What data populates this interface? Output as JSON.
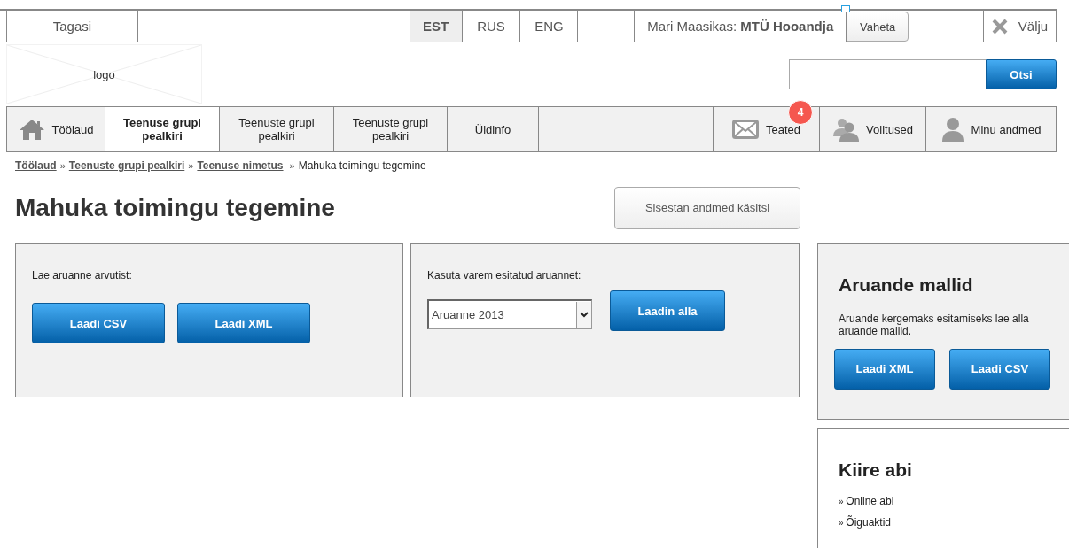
{
  "top_bar": {
    "back": "Tagasi",
    "languages": [
      {
        "label": "EST",
        "selected": true
      },
      {
        "label": "RUS",
        "selected": false
      },
      {
        "label": "ENG",
        "selected": false
      }
    ],
    "user": "Mari Maasikas: **MTÜ Hooandja**",
    "switch_button": "Vaheta",
    "logout": "Välju"
  },
  "logo": "logo",
  "search": {
    "button": "Otsi"
  },
  "nav": [
    {
      "label": "Töölaud",
      "kind": "home",
      "selected": false
    },
    {
      "label": "Teenuse grupi pealkiri",
      "kind": "text",
      "selected": true
    },
    {
      "label": "Teenuste grupi pealkiri",
      "kind": "text",
      "selected": false
    },
    {
      "label": "Teenuste grupi pealkiri",
      "kind": "text",
      "selected": false
    },
    {
      "label": "Üldinfo",
      "kind": "text",
      "selected": false
    },
    {
      "label": "Teated",
      "kind": "mail",
      "badge": "4",
      "selected": false
    },
    {
      "label": "Volitused",
      "kind": "users",
      "selected": false
    },
    {
      "label": "Minu andmed",
      "kind": "user",
      "selected": false
    }
  ],
  "breadcrumb": [
    {
      "label": "Töölaud",
      "link": true
    },
    {
      "sep": "»",
      "label": "Teenuste grupi pealkiri",
      "link": true
    },
    {
      "sep": "»",
      "label": "Teenuse nimetus",
      "link": true
    },
    {
      "sep": "»",
      "label": "Mahuka toimingu tegemine",
      "link": false
    }
  ],
  "title": "Mahuka toimingu tegemine",
  "manual_button": "Sisestan andmed käsitsi",
  "upload_panel": {
    "label": "Lae aruanne arvutist:",
    "buttons": [
      "Laadi CSV",
      "Laadi XML"
    ]
  },
  "previous_panel": {
    "label": "Kasuta varem esitatud aruannet:",
    "select_value": "Aruanne 2013",
    "button": "Laadin alla"
  },
  "templates": {
    "title": "Aruande mallid",
    "text": "Aruande kergemaks esitamiseks lae alla aruande mallid.",
    "buttons": [
      "Laadi XML",
      "Laadi CSV"
    ]
  },
  "help": {
    "title": "Kiire abi",
    "links": [
      {
        "bullet": "»",
        "label": "Online abi"
      },
      {
        "bullet": "»",
        "label": "Õiguaktid"
      }
    ]
  }
}
